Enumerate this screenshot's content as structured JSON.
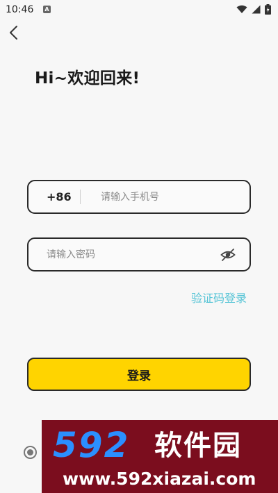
{
  "status_bar": {
    "time": "10:46",
    "app_icon_letter": "A"
  },
  "header": {
    "greeting": "Hi~欢迎回来!"
  },
  "form": {
    "country_code": "+86",
    "phone_placeholder": "请输入手机号",
    "password_placeholder": "请输入密码",
    "sms_login_link": "验证码登录",
    "login_button": "登录"
  },
  "watermark": {
    "logo": "592",
    "title": "软件园",
    "url": "www.592xiazai.com"
  },
  "colors": {
    "accent_yellow": "#ffd400",
    "link_cyan": "#56c4d6",
    "watermark_bg": "#7b0d1e",
    "watermark_logo": "#2b8fff"
  }
}
